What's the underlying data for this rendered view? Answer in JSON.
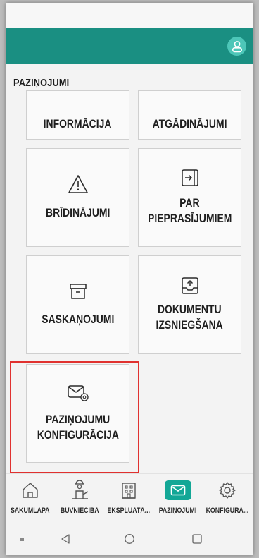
{
  "colors": {
    "appbar": "#1a8f82",
    "accent": "#13a796",
    "highlight": "#e0312f"
  },
  "header": {
    "profile_icon": "user-profile-icon"
  },
  "page": {
    "title": "PAZIŅOJUMI"
  },
  "tiles": [
    {
      "label_lines": [
        "INFORMĀCIJA"
      ],
      "icon": "info-icon",
      "partial": true
    },
    {
      "label_lines": [
        "ATGĀDINĀJUMI"
      ],
      "icon": "bell-icon",
      "partial": true
    },
    {
      "label_lines": [
        "BRĪDINĀJUMI"
      ],
      "icon": "warning-icon"
    },
    {
      "label_lines": [
        "PAR",
        "PIEPRASĪJUMIEM"
      ],
      "icon": "sign-in-icon"
    },
    {
      "label_lines": [
        "SASKAŅOJUMI"
      ],
      "icon": "archive-box-icon"
    },
    {
      "label_lines": [
        "DOKUMENTU",
        "IZSNIEGŠANA"
      ],
      "icon": "upload-tray-icon"
    },
    {
      "label_lines": [
        "PAZIŅOJUMU",
        "KONFIGURĀCIJA"
      ],
      "icon": "mail-settings-icon"
    }
  ],
  "bottom_nav": {
    "items": [
      {
        "label": "SĀKUMLAPA",
        "icon": "home-icon",
        "active": false
      },
      {
        "label": "BŪVNIECĪBA",
        "icon": "construction-worker-icon",
        "active": false
      },
      {
        "label": "EKSPLUATĀ...",
        "icon": "building-icon",
        "active": false
      },
      {
        "label": "PAZIŅOJUMI",
        "icon": "mail-icon",
        "active": true
      },
      {
        "label": "KONFIGURĀ...",
        "icon": "gear-icon",
        "active": false
      }
    ]
  },
  "system_nav": {
    "items": [
      "recents-square",
      "back-triangle",
      "home-circle",
      "overview-square"
    ]
  }
}
